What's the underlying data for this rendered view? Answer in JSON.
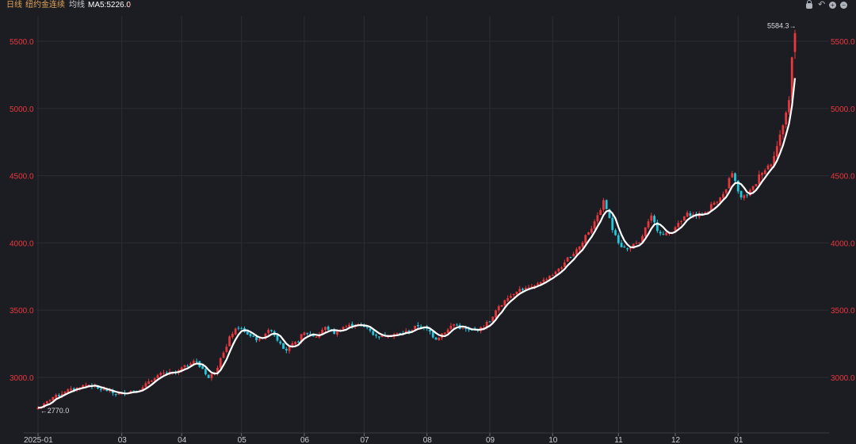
{
  "header": {
    "period": "日线",
    "symbol": "纽约金连续",
    "ma_name": "均线",
    "ma_value": "MA5:5226.0",
    "ma_arrow": "↑"
  },
  "toolbar": {
    "icons": [
      "lock-icon",
      "undo-icon",
      "zoom-in-icon",
      "zoom-out-icon"
    ]
  },
  "colors": {
    "background": "#1c1d22",
    "grid": "#2b2d33",
    "up": "#e8373d",
    "down": "#26c6da",
    "ma_line": "#ffffff",
    "axis_text": "#e8373d",
    "xaxis_text": "#c9ccd3"
  },
  "chart_data": {
    "type": "candlestick",
    "ylim": [
      2700,
      5620
    ],
    "y_ticks": [
      3000,
      3500,
      4000,
      4500,
      5000,
      5500
    ],
    "y_tick_labels": [
      "3000.0",
      "3500.0",
      "4000.0",
      "4500.0",
      "5000.0",
      "5500.0"
    ],
    "x_ticks": [
      "2025-01",
      "03",
      "04",
      "05",
      "06",
      "07",
      "08",
      "09",
      "10",
      "11",
      "12",
      "01"
    ],
    "x_tick_positions": [
      0,
      28,
      48,
      68,
      89,
      109,
      130,
      151,
      172,
      194,
      213,
      234
    ],
    "ma5_label": "MA5",
    "ma5_last": 5226.0,
    "annotations": [
      {
        "text": "←2770.0",
        "index": 1,
        "value": 2770.0,
        "anchor": "low"
      },
      {
        "text": "5584.3→",
        "index": 253,
        "value": 5584.3,
        "anchor": "high"
      }
    ],
    "anchors": [
      [
        0,
        2775
      ],
      [
        6,
        2860
      ],
      [
        10,
        2905
      ],
      [
        17,
        2945
      ],
      [
        21,
        2910
      ],
      [
        27,
        2875
      ],
      [
        30,
        2895
      ],
      [
        34,
        2910
      ],
      [
        38,
        2985
      ],
      [
        42,
        3030
      ],
      [
        46,
        3035
      ],
      [
        49,
        3080
      ],
      [
        52,
        3125
      ],
      [
        55,
        3065
      ],
      [
        57,
        2995
      ],
      [
        59,
        3045
      ],
      [
        62,
        3190
      ],
      [
        65,
        3330
      ],
      [
        67,
        3375
      ],
      [
        69,
        3335
      ],
      [
        71,
        3310
      ],
      [
        74,
        3275
      ],
      [
        76,
        3330
      ],
      [
        78,
        3355
      ],
      [
        80,
        3280
      ],
      [
        83,
        3205
      ],
      [
        86,
        3255
      ],
      [
        89,
        3330
      ],
      [
        93,
        3305
      ],
      [
        96,
        3370
      ],
      [
        99,
        3330
      ],
      [
        102,
        3375
      ],
      [
        106,
        3395
      ],
      [
        110,
        3370
      ],
      [
        113,
        3305
      ],
      [
        117,
        3315
      ],
      [
        121,
        3325
      ],
      [
        124,
        3345
      ],
      [
        127,
        3385
      ],
      [
        130,
        3355
      ],
      [
        133,
        3290
      ],
      [
        136,
        3340
      ],
      [
        139,
        3395
      ],
      [
        142,
        3360
      ],
      [
        145,
        3345
      ],
      [
        148,
        3365
      ],
      [
        151,
        3420
      ],
      [
        154,
        3520
      ],
      [
        157,
        3600
      ],
      [
        161,
        3655
      ],
      [
        165,
        3665
      ],
      [
        168,
        3715
      ],
      [
        172,
        3765
      ],
      [
        175,
        3825
      ],
      [
        178,
        3905
      ],
      [
        181,
        3975
      ],
      [
        184,
        4085
      ],
      [
        187,
        4195
      ],
      [
        189,
        4310
      ],
      [
        190,
        4255
      ],
      [
        192,
        4100
      ],
      [
        195,
        3975
      ],
      [
        197,
        3950
      ],
      [
        199,
        3985
      ],
      [
        201,
        3995
      ],
      [
        203,
        4110
      ],
      [
        205,
        4195
      ],
      [
        207,
        4100
      ],
      [
        209,
        4060
      ],
      [
        211,
        4075
      ],
      [
        214,
        4140
      ],
      [
        217,
        4215
      ],
      [
        220,
        4205
      ],
      [
        223,
        4225
      ],
      [
        226,
        4300
      ],
      [
        229,
        4360
      ],
      [
        232,
        4510
      ],
      [
        235,
        4335
      ],
      [
        237,
        4360
      ],
      [
        239,
        4415
      ],
      [
        242,
        4530
      ],
      [
        245,
        4590
      ],
      [
        247,
        4720
      ],
      [
        249,
        4880
      ],
      [
        251,
        5060
      ],
      [
        252,
        5380
      ],
      [
        253,
        5584
      ]
    ]
  }
}
